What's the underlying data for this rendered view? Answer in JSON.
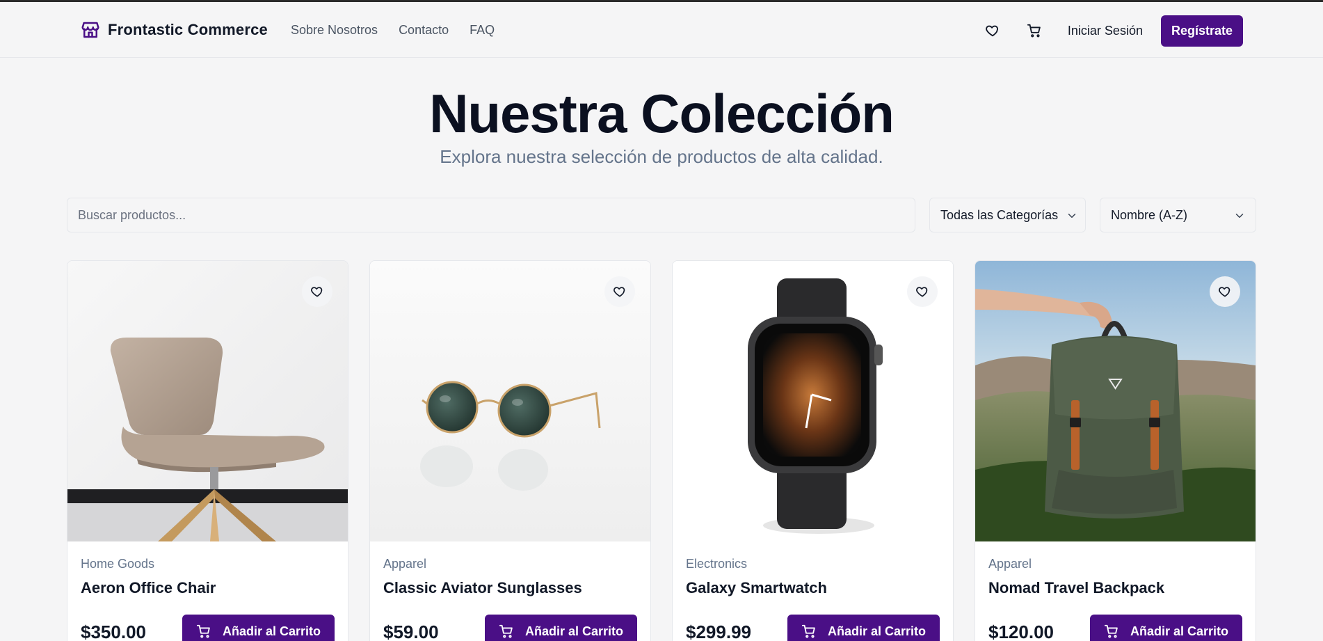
{
  "header": {
    "brand": "Frontastic Commerce",
    "nav": [
      "Sobre Nosotros",
      "Contacto",
      "FAQ"
    ],
    "login": "Iniciar Sesión",
    "register": "Regístrate"
  },
  "hero": {
    "title": "Nuestra Colección",
    "subtitle": "Explora nuestra selección de productos de alta calidad."
  },
  "filters": {
    "search_placeholder": "Buscar productos...",
    "category": "Todas las Categorías",
    "sort": "Nombre (A-Z)"
  },
  "products": [
    {
      "category": "Home Goods",
      "name": "Aeron Office Chair",
      "price": "$350.00",
      "cta": "Añadir al Carrito",
      "image": "chair"
    },
    {
      "category": "Apparel",
      "name": "Classic Aviator Sunglasses",
      "price": "$59.00",
      "cta": "Añadir al Carrito",
      "image": "sunglasses"
    },
    {
      "category": "Electronics",
      "name": "Galaxy Smartwatch",
      "price": "$299.99",
      "cta": "Añadir al Carrito",
      "image": "smartwatch"
    },
    {
      "category": "Apparel",
      "name": "Nomad Travel Backpack",
      "price": "$120.00",
      "cta": "Añadir al Carrito",
      "image": "backpack"
    }
  ],
  "colors": {
    "accent": "#4a0f86",
    "background": "#f5f5f6",
    "muted": "#64748b"
  },
  "icons": [
    "store-icon",
    "heart-icon",
    "cart-icon",
    "chevron-down-icon"
  ]
}
